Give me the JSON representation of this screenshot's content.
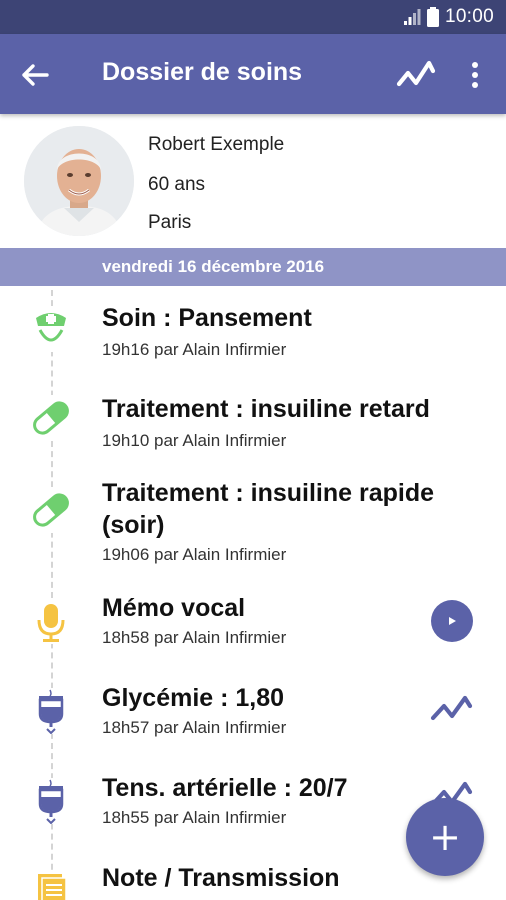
{
  "status_bar": {
    "time": "10:00"
  },
  "app_bar": {
    "title": "Dossier de soins",
    "back_icon": "arrow-left-icon",
    "chart_icon": "chart-line-icon",
    "more_icon": "more-vertical-icon"
  },
  "patient": {
    "name": "Robert Exemple",
    "age": "60 ans",
    "city": "Paris"
  },
  "date_header": "vendredi 16 décembre 2016",
  "entries": [
    {
      "title": "Soin : Pansement",
      "meta": "19h16 par Alain Infirmier",
      "icon": "nurse-icon"
    },
    {
      "title": "Traitement : insuiline retard",
      "meta": "19h10 par Alain Infirmier",
      "icon": "pill-icon"
    },
    {
      "title": "Traitement : insuiline rapide (soir)",
      "meta": "19h06 par Alain Infirmier",
      "icon": "pill-icon"
    },
    {
      "title": "Mémo vocal",
      "meta": "18h58 par Alain Infirmier",
      "icon": "microphone-icon",
      "action": "play-icon"
    },
    {
      "title": "Glycémie : 1,80",
      "meta": "18h57 par Alain Infirmier",
      "icon": "iv-drip-icon",
      "action": "chart-line-icon"
    },
    {
      "title": "Tens. artérielle : 20/7",
      "meta": "18h55 par Alain Infirmier",
      "icon": "iv-drip-icon",
      "action": "chart-line-icon"
    },
    {
      "title": "Note / Transmission",
      "meta": "",
      "icon": "note-icon"
    }
  ],
  "fab": {
    "label": "+"
  },
  "colors": {
    "status_bar": "#3d4475",
    "primary": "#5b62a8",
    "date_band": "#8f94c6",
    "green": "#6fcf6f",
    "yellow": "#f5c342"
  }
}
